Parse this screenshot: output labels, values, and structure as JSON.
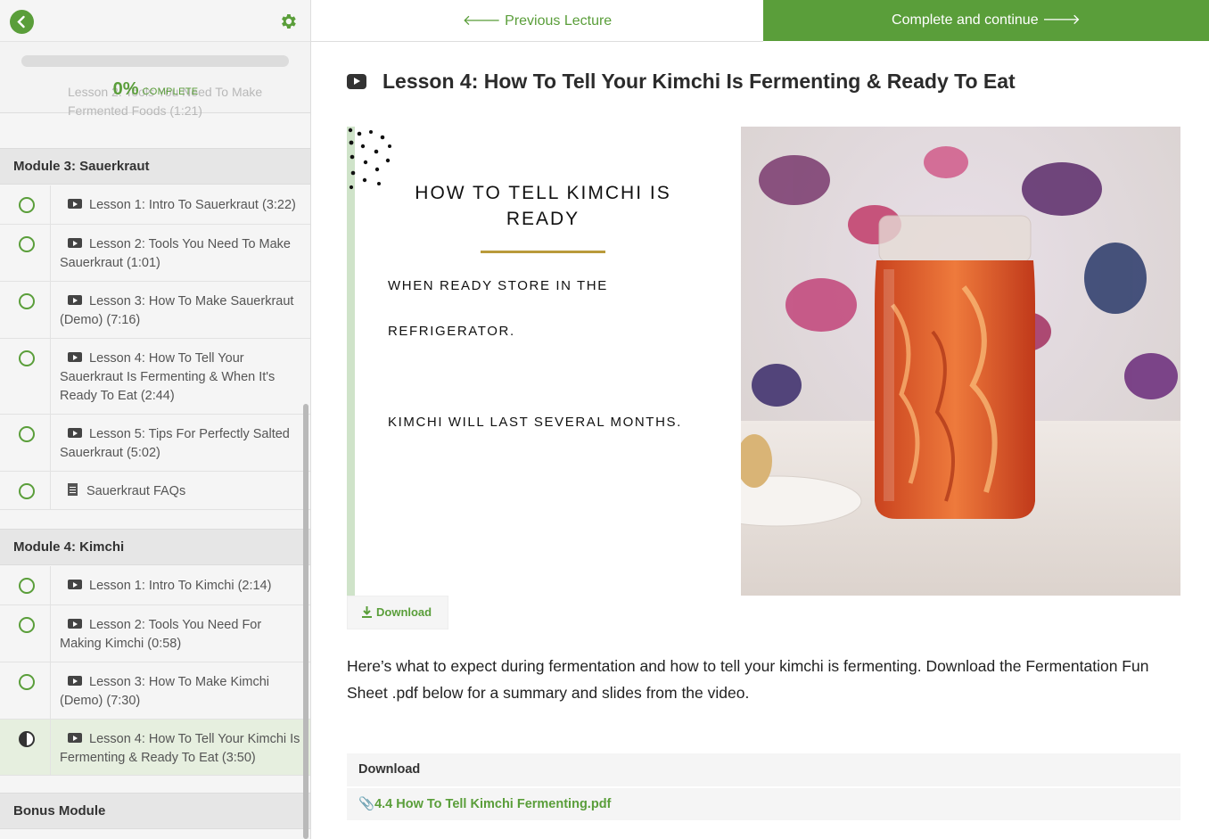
{
  "colors": {
    "accent": "#5a9e3a",
    "accent_bg_active": "#e6efdf"
  },
  "nav": {
    "back_icon": "chevron-left-icon",
    "settings_icon": "gear-icon",
    "prev_label": "Previous Lecture",
    "next_label": "Complete and continue"
  },
  "progress": {
    "percent_text": "0%",
    "label": "COMPLETE",
    "value": 0
  },
  "sidebar": {
    "ghost_lesson": "Lesson 2: Tools You Need To Make Fermented Foods (1:21)",
    "module3": {
      "title": "Module 3: Sauerkraut",
      "items": [
        {
          "type": "video",
          "label": "Lesson 1: Intro To Sauerkraut (3:22)"
        },
        {
          "type": "video",
          "label": "Lesson 2: Tools You Need To Make Sauerkraut (1:01)"
        },
        {
          "type": "video",
          "label": "Lesson 3: How To Make Sauerkraut (Demo) (7:16)"
        },
        {
          "type": "video",
          "label": "Lesson 4: How To Tell Your Sauerkraut Is Fermenting & When It's Ready To Eat (2:44)"
        },
        {
          "type": "video",
          "label": "Lesson 5: Tips For Perfectly Salted Sauerkraut (5:02)"
        },
        {
          "type": "doc",
          "label": "Sauerkraut FAQs"
        }
      ]
    },
    "module4": {
      "title": "Module 4: Kimchi",
      "items": [
        {
          "type": "video",
          "label": "Lesson 1: Intro To Kimchi (2:14)"
        },
        {
          "type": "video",
          "label": "Lesson 2: Tools You Need For Making Kimchi (0:58)"
        },
        {
          "type": "video",
          "label": "Lesson 3: How To Make Kimchi (Demo) (7:30)"
        },
        {
          "type": "video",
          "label": "Lesson 4: How To Tell Your Kimchi Is Fermenting & Ready To Eat (3:50)",
          "active": true
        }
      ]
    },
    "bonus": {
      "title": "Bonus Module"
    }
  },
  "lesson": {
    "title": "Lesson 4: How To Tell Your Kimchi Is Fermenting & Ready To Eat",
    "slide": {
      "heading": "HOW TO TELL KIMCHI IS READY",
      "line1": "WHEN READY STORE IN THE",
      "line2": "REFRIGERATOR.",
      "line3": "KIMCHI WILL LAST SEVERAL MONTHS."
    },
    "download_button": "Download",
    "description": "Here’s what to expect during fermentation and how to tell your kimchi is fermenting. Download the Fermentation Fun Sheet .pdf below for a summary and slides from the video.",
    "downloads_header": "Download",
    "file_name": "4.4 How To Tell Kimchi Fermenting.pdf"
  }
}
